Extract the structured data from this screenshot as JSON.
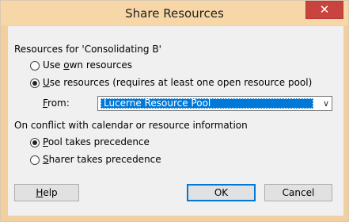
{
  "window": {
    "title": "Share Resources",
    "close_label": "✕"
  },
  "resources_group": {
    "heading": "Resources for 'Consolidating B'",
    "own": {
      "prefix": "Use ",
      "mnemonic": "o",
      "suffix": "wn resources",
      "selected": false
    },
    "pool": {
      "prefix": "",
      "mnemonic": "U",
      "suffix": "se resources (requires at least one open resource pool)",
      "selected": true
    },
    "from": {
      "mnemonic": "F",
      "suffix": "rom:",
      "value": "Lucerne Resource Pool"
    }
  },
  "conflict_group": {
    "heading": "On conflict with calendar or resource information",
    "pool_precedence": {
      "mnemonic": "P",
      "suffix": "ool takes precedence",
      "selected": true
    },
    "sharer_precedence": {
      "mnemonic": "S",
      "suffix": "harer takes precedence",
      "selected": false
    }
  },
  "buttons": {
    "help": {
      "mnemonic": "H",
      "suffix": "elp"
    },
    "ok": "OK",
    "cancel": "Cancel"
  },
  "colors": {
    "titlebar": "#f7d7a7",
    "close": "#c9443f",
    "selection": "#0078d7",
    "client": "#f0f0f0"
  }
}
